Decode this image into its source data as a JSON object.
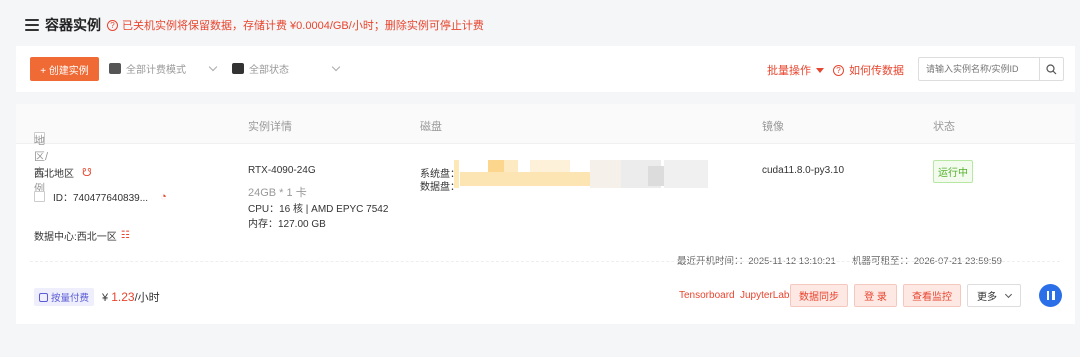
{
  "header": {
    "title": "容器实例",
    "notice": "已关机实例将保留数据，存储计费 ¥0.0004/GB/小时；删除实例可停止计费"
  },
  "toolbar": {
    "create_label": "+ 创建实例",
    "billing_filter": "全部计费模式",
    "status_filter": "全部状态",
    "batch_label": "批量操作",
    "howto_label": "如何传数据",
    "search_placeholder": "请输入实例名称/实例ID"
  },
  "table": {
    "columns": [
      "地区/实例",
      "实例详情",
      "磁盘",
      "镜像",
      "状态"
    ]
  },
  "instance": {
    "region": "西北地区",
    "id": "ID：740477640839...",
    "datacenter": "数据中心:西北一区",
    "gpu": "RTX-4090-24G",
    "gpu_mem": "24GB * 1 卡",
    "cpu": "CPU：16 核 | AMD EPYC 7542",
    "ram": "内存：127.00 GB",
    "system_disk_label": "系统盘：",
    "data_disk_label": "数据盘：",
    "image": "cuda11.8.0-py3.10",
    "status": "运行中",
    "last_boot": "最近开机时间：：2025-11-12 13:10:21",
    "rentable_until": "机器可租至：：2026-07-21 23:59:59",
    "billing_tag": "按量付费",
    "price_prefix": "¥ ",
    "price_value": "1.23",
    "price_suffix": "/小时",
    "link_tensorboard": "Tensorboard",
    "link_jupyter": "JupyterLab",
    "btn_sync": "数据同步",
    "btn_login": "登 录",
    "btn_monitor": "查看监控",
    "btn_more": "更多"
  },
  "colors": {
    "accent": "#f06a35",
    "danger_text": "#e8452e",
    "running": "#52b029",
    "pause_button": "#2b6fe8"
  }
}
